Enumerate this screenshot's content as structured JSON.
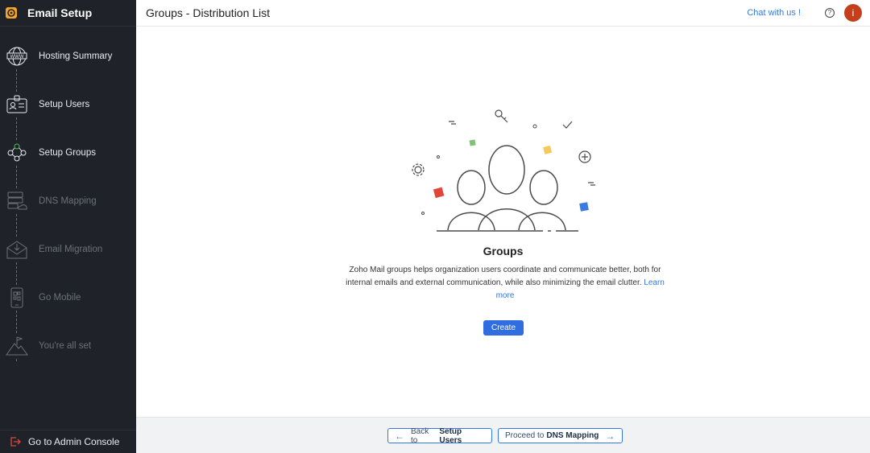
{
  "sidebar": {
    "title": "Email Setup",
    "steps": [
      {
        "label": "Hosting Summary",
        "state": "active",
        "icon": "www-globe-icon"
      },
      {
        "label": "Setup Users",
        "state": "active",
        "icon": "id-card-icon"
      },
      {
        "label": "Setup Groups",
        "state": "active",
        "icon": "group-network-icon"
      },
      {
        "label": "DNS Mapping",
        "state": "inactive",
        "icon": "server-cloud-icon"
      },
      {
        "label": "Email Migration",
        "state": "inactive",
        "icon": "envelope-download-icon"
      },
      {
        "label": "Go Mobile",
        "state": "inactive",
        "icon": "mobile-qr-icon"
      },
      {
        "label": "You're all set",
        "state": "inactive",
        "icon": "mountain-flag-icon"
      }
    ],
    "admin_label": "Go to Admin Console"
  },
  "header": {
    "title": "Groups - Distribution List",
    "chat_label": "Chat with us !",
    "help_icon": "?",
    "avatar_initial": "i"
  },
  "main": {
    "heading": "Groups",
    "description": "Zoho Mail groups helps organization users coordinate and communicate better, both for internal emails and external communication, while also minimizing the email clutter.",
    "learn_more": "Learn more",
    "create_label": "Create"
  },
  "footer": {
    "back_prefix": "Back to",
    "back_target": "Setup Users",
    "next_prefix": "Proceed to",
    "next_target": "DNS Mapping"
  },
  "colors": {
    "sidebar_bg": "#1f2329",
    "accent": "#2f6de1",
    "link": "#3478e5",
    "avatar": "#c4401c"
  }
}
